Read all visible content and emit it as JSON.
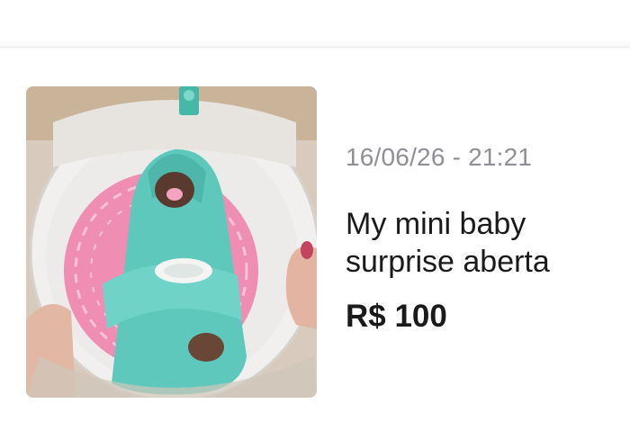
{
  "listing": {
    "date": "16/06/26 - 21:21",
    "title_line1": "My mini baby",
    "title_line2": "surprise aberta",
    "price": "R$ 100"
  },
  "colors": {
    "text_primary": "#1a1a1a",
    "text_secondary": "#8f8f96",
    "blanket": "#5ec8bd",
    "pad": "#f08bb2"
  }
}
